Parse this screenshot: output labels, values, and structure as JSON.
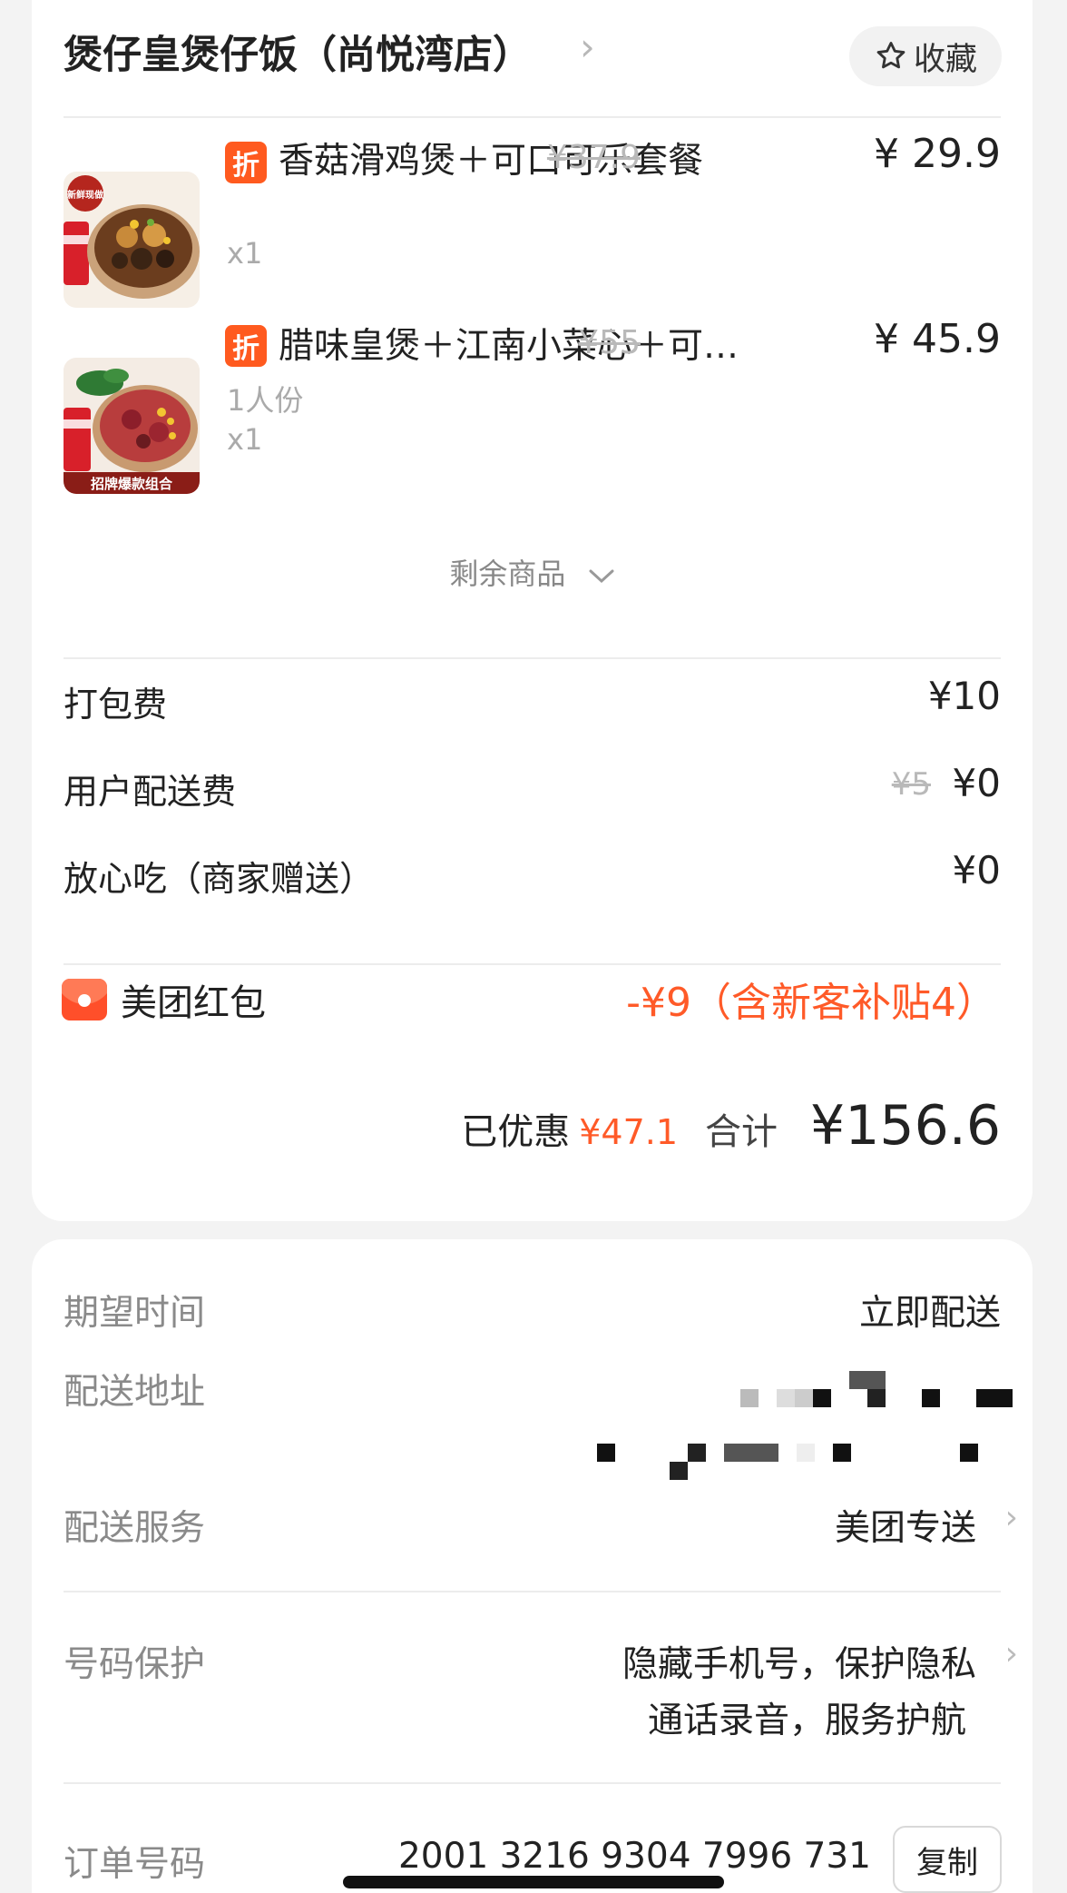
{
  "shop": {
    "name": "煲仔皇煲仔饭（尚悦湾店）",
    "chevron": "›",
    "favorite_label": "收藏"
  },
  "items": [
    {
      "badge": "折",
      "name": "香菇滑鸡煲＋可口可乐套餐",
      "original_price": "¥37.9",
      "price": "¥ 29.9",
      "spec": "",
      "qty": "x1"
    },
    {
      "badge": "折",
      "name": "腊味皇煲＋江南小菜心＋可…",
      "original_price": "¥55",
      "price": "¥ 45.9",
      "spec": "1人份",
      "qty": "x1"
    }
  ],
  "item_image_text": {
    "item1_tag": "新鲜现做",
    "item2_banner": "招牌爆款组合"
  },
  "more_items_label": "剩余商品",
  "fees": [
    {
      "label": "打包费",
      "original": "",
      "value": "¥10"
    },
    {
      "label": "用户配送费",
      "original": "¥5",
      "value": "¥0"
    },
    {
      "label": "放心吃（商家赠送）",
      "original": "",
      "value": "¥0"
    }
  ],
  "redpack": {
    "label": "美团红包",
    "value": "-¥9（含新客补贴4）"
  },
  "summary": {
    "saved_label": "已优惠",
    "saved_value": "¥47.1",
    "total_label": "合计",
    "total_value": "¥156.6"
  },
  "delivery": {
    "expected_time_label": "期望时间",
    "expected_time_value": "立即配送",
    "address_label": "配送地址",
    "service_label": "配送服务",
    "service_value": "美团专送",
    "privacy_label": "号码保护",
    "privacy_line1": "隐藏手机号，保护隐私",
    "privacy_line2": "通话录音，服务护航",
    "order_label": "订单号码",
    "order_value": "2001 3216 9304 7996 731",
    "copy_label": "复制"
  },
  "colors": {
    "accent_red": "#ff5a28",
    "badge_orange": "#ff5a1f",
    "background": "#f3f3f3"
  }
}
